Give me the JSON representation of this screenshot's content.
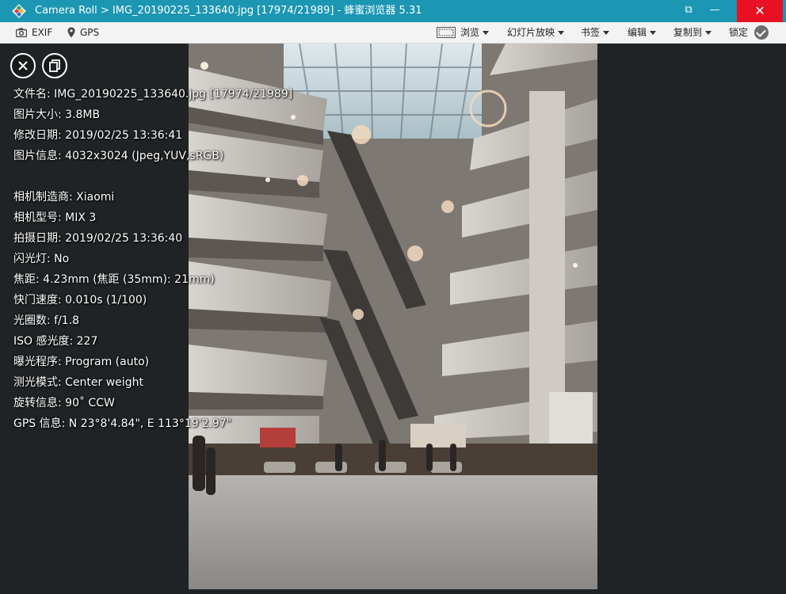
{
  "window": {
    "title": "Camera Roll > IMG_20190225_133640.jpg [17974/21989] - 蜂蜜浏览器 5.31",
    "restore_label": "⧉",
    "minimize_label": "—",
    "close_label": "✕"
  },
  "toolbar": {
    "exif_label": "EXIF",
    "gps_label": "GPS",
    "browse_label": "浏览",
    "slideshow_label": "幻灯片放映",
    "bookmark_label": "书签",
    "edit_label": "编辑",
    "copy_to_label": "复制到",
    "lock_label": "锁定"
  },
  "info": {
    "filename": "文件名: IMG_20190225_133640.jpg [17974/21989]",
    "size": "图片大小: 3.8MB",
    "modified": "修改日期: 2019/02/25 13:36:41",
    "image_info": "图片信息: 4032x3024 (Jpeg,YUV,sRGB)",
    "maker": "相机制造商: Xiaomi",
    "model": "相机型号: MIX 3",
    "taken": "拍摄日期: 2019/02/25 13:36:40",
    "flash": "闪光灯: No",
    "focal": "焦距: 4.23mm (焦距 (35mm): 21mm)",
    "shutter": "快门速度: 0.010s (1/100)",
    "aperture": "光圈数: f/1.8",
    "iso": "ISO 感光度: 227",
    "exposure_program": "曝光程序: Program (auto)",
    "metering": "测光模式: Center weight",
    "rotation": "旋转信息: 90˚ CCW",
    "gps": "GPS 信息: N 23°8'4.84\", E 113°19'2.97\""
  },
  "colors": {
    "titlebar": "#1b96b3",
    "close_red": "#e81123",
    "viewer_bg": "#1f2325"
  },
  "icons": {
    "camera": "camera-icon",
    "pin": "location-pin-icon",
    "browse": "frame-icon",
    "close": "close-icon",
    "copy": "copy-icon",
    "lock": "check-badge-icon"
  }
}
